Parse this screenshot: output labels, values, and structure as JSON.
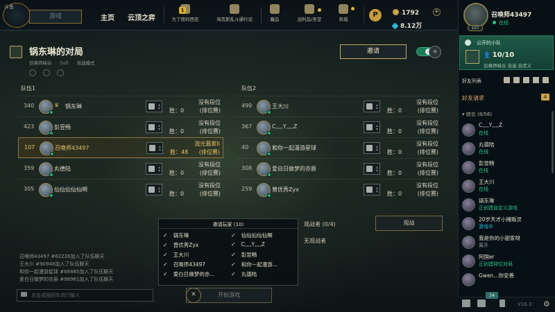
{
  "colors": {
    "accent_gold": "#c8aa6e",
    "online_green": "#2ac387",
    "ingame_blue": "#2fb8d8",
    "party_green": "#1d5a48",
    "self_gold": "#e6c56a"
  },
  "topnav": {
    "logo_text": "斗鱼",
    "play_button": "游戏",
    "home": "主页",
    "tft": "云顶之弈",
    "badge_count": "1",
    "icons": [
      {
        "label": "为了德玛西亚",
        "icon": "demacia-icon"
      },
      {
        "label": "海克斯乱斗通行证",
        "icon": "hextech-icon"
      },
      {
        "label": "藏品",
        "icon": "collection-icon"
      },
      {
        "label": "战利品/圣堂",
        "icon": "loot-icon"
      },
      {
        "label": "商城",
        "icon": "store-icon"
      }
    ],
    "pass_icon": "P",
    "currency_be": "1792",
    "currency_rp": "8.12万",
    "plus": "+"
  },
  "profile": {
    "name": "召唤师43497",
    "status": "在线",
    "level": "107"
  },
  "lobby": {
    "title": "锅东琳的对局",
    "map": "召唤师峡谷",
    "format": "5v5",
    "mode": "自选模式",
    "invite_label": "邀请",
    "add_member_icon": "+"
  },
  "teams": [
    {
      "label": "队伍1",
      "players": [
        {
          "level": "340",
          "name": "锅东琳",
          "crown": "♛",
          "rank": "没有段位",
          "wins": "胜：0",
          "rank2": "(排位赛)",
          "role_icon": "jungle-icon",
          "self": false
        },
        {
          "level": "423",
          "name": "彭昱畅",
          "crown": "",
          "rank": "没有段位",
          "wins": "胜：0",
          "rank2": "(排位赛)",
          "role_icon": "support-icon",
          "self": false
        },
        {
          "level": "107",
          "name": "召唤师43497",
          "crown": "",
          "rank": "流光翡翠II",
          "wins": "胜：48",
          "rank2": "(排位赛)",
          "role_icon": "mid-icon",
          "self": true
        },
        {
          "level": "359",
          "name": "丸德陆",
          "crown": "",
          "rank": "没有段位",
          "wins": "胜：0",
          "rank2": "(排位赛)",
          "role_icon": "sword-icon",
          "self": false
        },
        {
          "level": "305",
          "name": "仙仙仙仙仙啊",
          "crown": "",
          "rank": "没有段位",
          "wins": "胜：0",
          "rank2": "(排位赛)",
          "role_icon": "jungle-icon",
          "self": false
        }
      ]
    },
    {
      "label": "队伍2",
      "players": [
        {
          "level": "499",
          "name": "王大川",
          "crown": "",
          "rank": "没有段位",
          "wins": "胜：0",
          "rank2": "(排位赛)",
          "role_icon": "jungle-icon",
          "self": false
        },
        {
          "level": "367",
          "name": "C,,,,Y,,,,Z",
          "crown": "",
          "rank": "没有段位",
          "wins": "胜：0",
          "rank2": "(排位赛)",
          "role_icon": "support-icon",
          "self": false
        },
        {
          "level": "40",
          "name": "和你一起漫游星球",
          "crown": "",
          "rank": "没有段位",
          "wins": "胜：0",
          "rank2": "(排位赛)",
          "role_icon": "sword-icon",
          "self": false
        },
        {
          "level": "308",
          "name": "爱白日做梦的亦辰",
          "crown": "",
          "rank": "没有段位",
          "wins": "胜：0",
          "rank2": "(排位赛)",
          "role_icon": "jungle-icon",
          "self": false
        },
        {
          "level": "259",
          "name": "曾优秀Zyx",
          "crown": "",
          "rank": "没有段位",
          "wins": "胜：0",
          "rank2": "(排位赛)",
          "role_icon": "jungle-icon",
          "self": false
        }
      ]
    }
  ],
  "invites": {
    "header": "邀请玩家 (10)",
    "col1": [
      "锅东琳",
      "曾优秀Zyx",
      "王大川",
      "召唤师43497",
      "爱白日做梦的亦..."
    ],
    "col2": [
      "仙仙仙仙仙啊",
      "C,,,,Y,,,,Z",
      "彭昱畅",
      "和你一起漫游...",
      "丸德陆"
    ]
  },
  "spectators": {
    "label": "观战者 (0/4)",
    "none": "无观战者",
    "button": "观战"
  },
  "chat": {
    "lines": [
      "召唤师43497 #62226加入了队伍聊天",
      "王大川 #90948加入了队伍聊天",
      "和你一起漫游星球 #68885加入了队伍聊天",
      "爱白日做梦的亦辰 #98961加入了队伍聊天"
    ],
    "placeholder": "点击或按回车进行输入",
    "start": "开始游戏",
    "cancel": "✕"
  },
  "party": {
    "title": "公开的小队",
    "count": "10/10",
    "mode": "召唤师峡谷 自选 自定义"
  },
  "friends": {
    "header": "好友列表",
    "requests": "好友请求",
    "requests_count": "4",
    "group": "▾ 综合 (8/56)",
    "list": [
      {
        "name": "C,,,,Y,,,,Z",
        "status": "在线",
        "kind": "online"
      },
      {
        "name": "丸德陆",
        "status": "在线",
        "kind": "online"
      },
      {
        "name": "彭昱畅",
        "status": "在线",
        "kind": "online"
      },
      {
        "name": "王大川",
        "status": "在线",
        "kind": "online"
      },
      {
        "name": "锅东琳",
        "status": "正创建自定义游戏",
        "kind": "online"
      },
      {
        "name": "20岁天才小摊贩灵",
        "status": "游戏中",
        "kind": "ingame"
      },
      {
        "name": "我是你的小甜家呀",
        "status": "离开",
        "kind": "away"
      },
      {
        "name": "阿国er",
        "status": "正创建排位对局",
        "kind": "online"
      },
      {
        "name": "Gwen...你安善",
        "status": "",
        "kind": "online"
      }
    ]
  },
  "sidebar_bottom": {
    "badge": "34",
    "version": "V16.3"
  }
}
